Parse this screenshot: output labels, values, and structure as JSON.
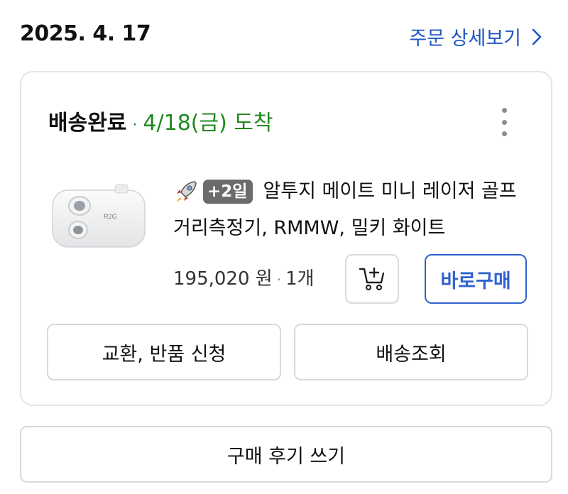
{
  "order": {
    "date": "2025. 4. 17",
    "detail_link": "주문 상세보기"
  },
  "delivery": {
    "status": "배송완료",
    "separator": "·",
    "arrival": "4/18(금) 도착"
  },
  "product": {
    "badge": "+2일",
    "title_line1": "알투지 메이트 미니 레이저 골프",
    "title_line2": "거리측정기, RMMW, 밀키 화이트",
    "price": "195,020 원",
    "separator": "·",
    "quantity": "1개",
    "buy_now_label": "바로구매"
  },
  "actions": {
    "exchange_return": "교환, 반품 신청",
    "tracking": "배송조회",
    "write_review": "구매 후기 쓰기"
  },
  "icons": {
    "detail_chevron": "chevron-right-icon",
    "more": "more-vertical-icon",
    "delivery_speed": "rocket-icon",
    "cart": "add-to-cart-icon"
  },
  "colors": {
    "link": "#1f55c4",
    "arrival_green": "#1f8a1f",
    "buy_blue": "#2f62cf",
    "badge_gray": "#6b6b6b"
  }
}
